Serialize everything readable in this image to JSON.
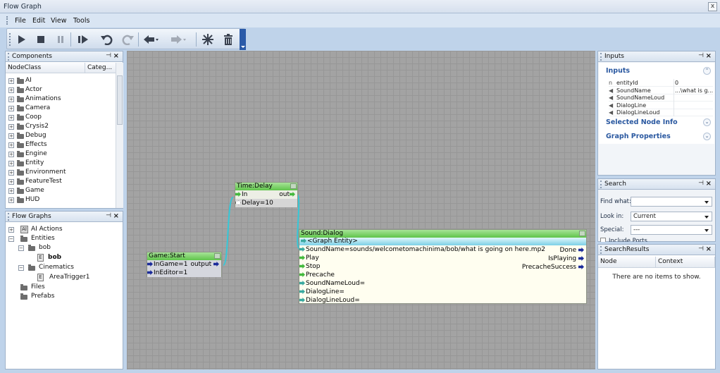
{
  "window": {
    "title": "Flow Graph"
  },
  "menu": [
    "File",
    "Edit",
    "View",
    "Tools"
  ],
  "components": {
    "title": "Components",
    "columns": [
      "NodeClass",
      "Categ..."
    ],
    "items": [
      "AI",
      "Actor",
      "Animations",
      "Camera",
      "Coop",
      "Crysis2",
      "Debug",
      "Effects",
      "Engine",
      "Entity",
      "Environment",
      "FeatureTest",
      "Game",
      "HUD"
    ]
  },
  "flowgraphs": {
    "title": "Flow Graphs",
    "ai_actions": "AI Actions",
    "entities": "Entities",
    "bob_folder": "bob",
    "bob_item": "bob",
    "cinematics": "Cinematics",
    "areatrigger": "AreaTrigger1",
    "files": "Files",
    "prefabs": "Prefabs",
    "doc_glyph": "E",
    "ai_glyph": "AI"
  },
  "nodes": {
    "game_start": {
      "title": "Game:Start",
      "in1": "InGame=1",
      "in2": "InEditor=1",
      "out": "output"
    },
    "time_delay": {
      "title": "Time:Delay",
      "in1": "In",
      "in2": "Delay=10",
      "out": "out"
    },
    "sound_dialog": {
      "title": "Sound:Dialog",
      "entity": "<Graph Entity>",
      "ports": [
        "SoundName=sounds/welcometomachinima/bob/what is going on here.mp2",
        "Play",
        "Stop",
        "Precache",
        "SoundNameLoud=",
        "DialogLine=",
        "DialogLineLoud="
      ],
      "outs": [
        "Done",
        "IsPlaying",
        "PrecacheSuccess"
      ]
    }
  },
  "inputs": {
    "title": "Inputs",
    "section": "Inputs",
    "rows": [
      {
        "name": "entityId",
        "value": "0",
        "icon": "n"
      },
      {
        "name": "SoundName",
        "value": "...\\what is g...",
        "icon": "speaker"
      },
      {
        "name": "SoundNameLoud",
        "value": "",
        "icon": "speaker"
      },
      {
        "name": "DialogLine",
        "value": "",
        "icon": "speaker"
      },
      {
        "name": "DialogLineLoud",
        "value": "",
        "icon": "speaker"
      }
    ],
    "selected_info": "Selected Node Info",
    "graph_props": "Graph Properties"
  },
  "search": {
    "title": "Search",
    "find_label": "Find what:",
    "lookin_label": "Look in:",
    "lookin_value": "Current",
    "special_label": "Special:",
    "special_value": "---",
    "include_ports": "Include Ports"
  },
  "results": {
    "title": "SearchResults",
    "columns": [
      "Node",
      "Context"
    ],
    "empty": "There are no items to show."
  }
}
